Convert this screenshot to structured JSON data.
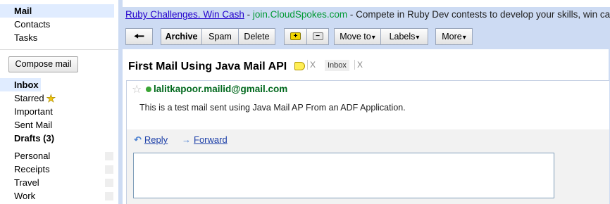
{
  "nav": {
    "top_items": [
      "Mail",
      "Contacts",
      "Tasks"
    ],
    "compose_label": "Compose mail",
    "folders": [
      {
        "label": "Inbox",
        "selected": true
      },
      {
        "label": "Starred"
      },
      {
        "label": "Important"
      },
      {
        "label": "Sent Mail"
      },
      {
        "label": "Drafts (3)"
      }
    ],
    "labels": [
      "Personal",
      "Receipts",
      "Travel",
      "Work"
    ]
  },
  "ad": {
    "title": "Ruby Challenges. Win Cash",
    "separator": " - ",
    "domain": "join.CloudSpokes.com",
    "text": " - Compete in Ruby Dev contests to develop your skills, win cash"
  },
  "toolbar": {
    "back_glyph": "🠔",
    "archive": "Archive",
    "spam": "Spam",
    "delete": "Delete",
    "add_label_glyph": "+",
    "remove_label_glyph": "−",
    "move_to": "Move to",
    "labels": "Labels",
    "more": "More",
    "caret": "▾"
  },
  "message": {
    "subject": "First Mail Using Java Mail API",
    "tag_close": "X",
    "inbox_tag": "Inbox",
    "sender": "lalitkapoor.mailid@gmail.com",
    "body": "This is a test mail sent using Java Mail AP From an ADF Application.",
    "reply_label": "Reply",
    "forward_label": "Forward"
  },
  "colors": {
    "frame": "#cddbf3",
    "selected_nav": "#e0ecff",
    "sender_green": "#00681c",
    "ad_link": "#2200cc",
    "ad_domain": "#009933"
  }
}
